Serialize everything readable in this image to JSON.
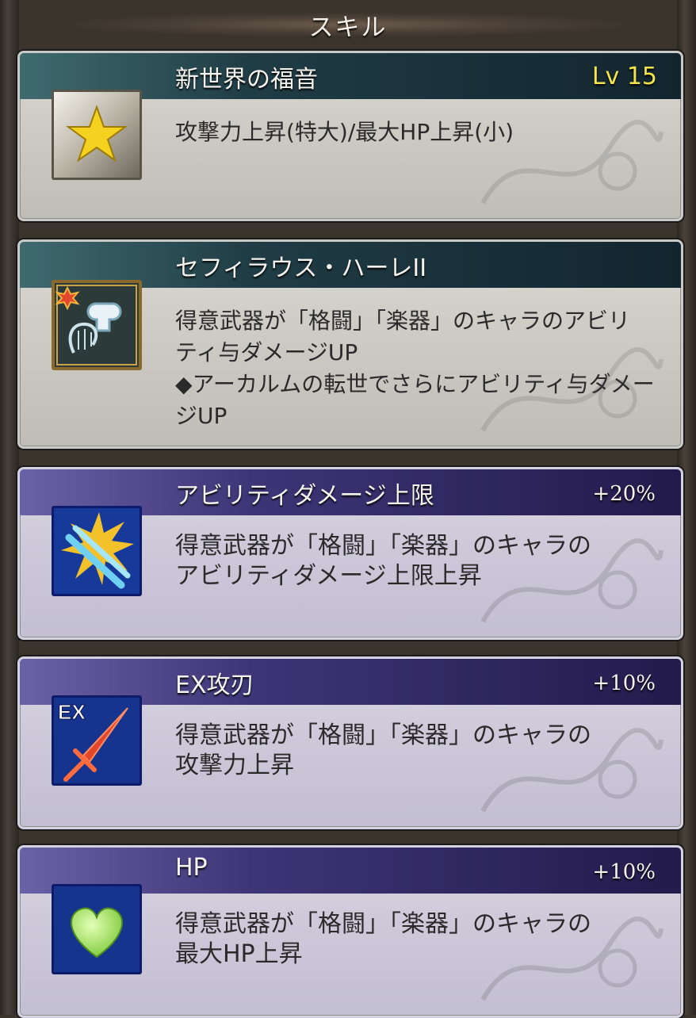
{
  "header": {
    "title": "スキル"
  },
  "skills": [
    {
      "name": "新世界の福音",
      "level": "Lv 15",
      "description": "攻撃力上昇(特大)/最大HP上昇(小)",
      "icon": "gold-star-icon"
    },
    {
      "name": "セフィラウス・ハーレII",
      "description": "得意武器が「格闘」「楽器」のキャラのアビリ\nティ与ダメージUP\n◆アーカルムの転世でさらにアビリティ与ダメー\nジUP",
      "icon": "fist-harp-icon"
    },
    {
      "name": "アビリティダメージ上限",
      "bonus": "+20%",
      "description": "得意武器が「格闘」「楽器」のキャラの\nアビリティダメージ上限上昇",
      "icon": "swords-burst-icon"
    },
    {
      "name": "EX攻刃",
      "bonus": "+10%",
      "description": "得意武器が「格闘」「楽器」のキャラの\n攻撃力上昇",
      "icon": "ex-blade-icon",
      "icon_label": "EX"
    },
    {
      "name": "HP",
      "bonus": "+10%",
      "description": "得意武器が「格闘」「楽器」のキャラの\n最大HP上昇",
      "icon": "green-heart-icon"
    }
  ]
}
